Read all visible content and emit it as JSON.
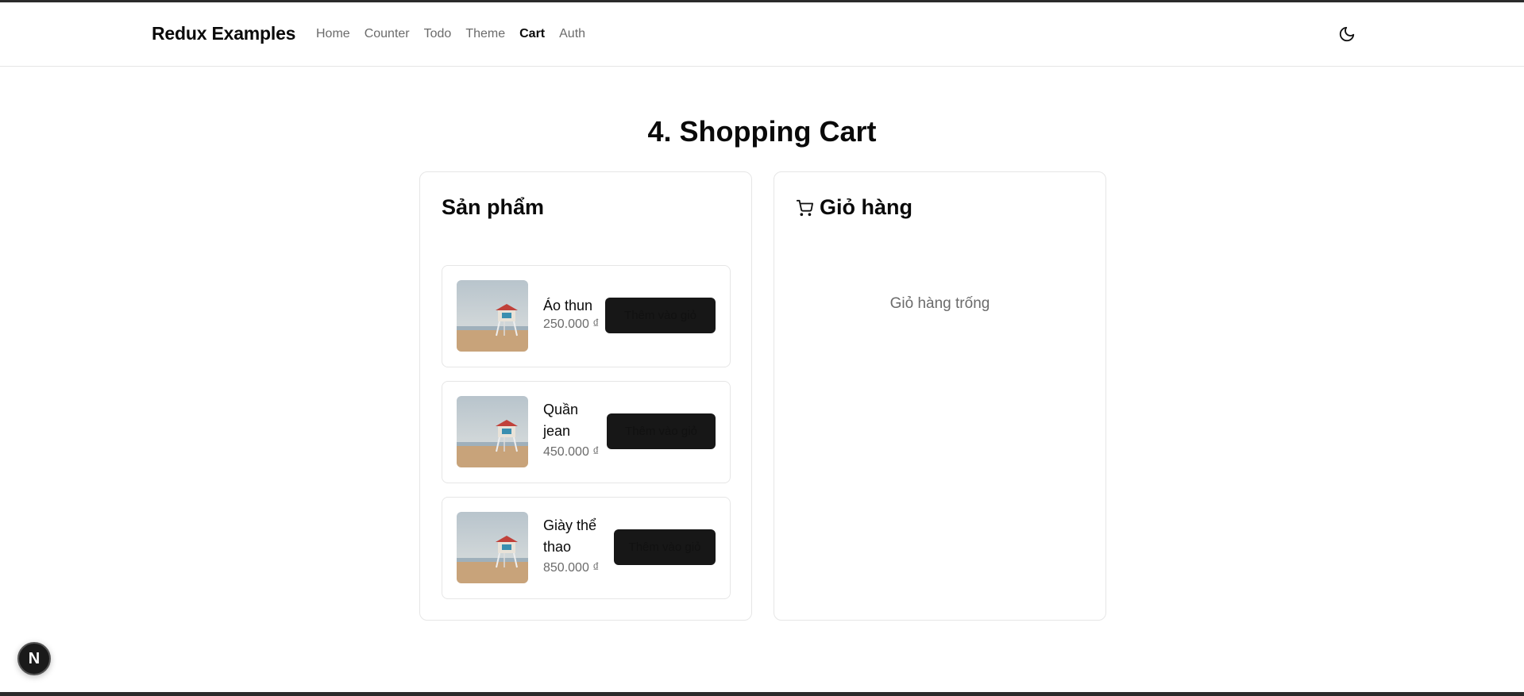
{
  "header": {
    "brand": "Redux Examples",
    "nav": [
      "Home",
      "Counter",
      "Todo",
      "Theme",
      "Cart",
      "Auth"
    ],
    "active_nav": "Cart",
    "theme_icon": "moon-icon"
  },
  "page_title": "4. Shopping Cart",
  "products_panel": {
    "title": "Sản phẩm",
    "items": [
      {
        "name": "Áo thun",
        "price": "250.000 ₫",
        "button_label": "Thêm vào giỏ",
        "image_icon": "lifeguard-tower-photo"
      },
      {
        "name": "Quần jean",
        "price": "450.000 ₫",
        "button_label": "Thêm vào giỏ",
        "image_icon": "lifeguard-tower-photo"
      },
      {
        "name": "Giày thể thao",
        "price": "850.000 ₫",
        "button_label": "Thêm vào giỏ",
        "image_icon": "lifeguard-tower-photo"
      }
    ]
  },
  "cart_panel": {
    "title": "Giỏ hàng",
    "icon": "shopping-cart-icon",
    "empty_message": "Giỏ hàng trống"
  },
  "dev_badge": {
    "label": "N",
    "icon": "nextjs-logo-icon"
  },
  "colors": {
    "accent": "#171717",
    "muted_text": "#6b6b6b",
    "border": "#e6e6e6"
  }
}
